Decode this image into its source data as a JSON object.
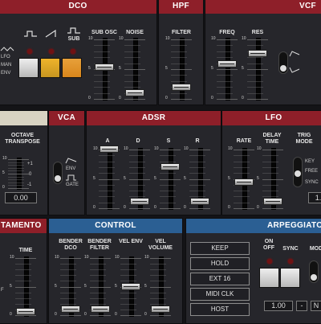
{
  "sections": {
    "dco": "DCO",
    "hpf": "HPF",
    "vcf": "VCF",
    "vca": "VCA",
    "adsr": "ADSR",
    "lfo": "LFO",
    "portamento": "TAMENTO",
    "control": "CONTROL",
    "arpeggiator": "ARPEGGIATOR"
  },
  "dco": {
    "sub_label": "SUB",
    "sub_osc_label": "SUB OSC",
    "noise_label": "NOISE",
    "lfo_mode": "LFO",
    "man_mode": "MAN",
    "env_mode": "ENV"
  },
  "hpf": {
    "filter_label": "FILTER"
  },
  "vcf": {
    "freq_label": "FREQ",
    "res_label": "RES"
  },
  "octave": {
    "label": "OCTAVE TRANSPOSE",
    "plus1": "+1",
    "zero": "0",
    "minus1": "-1",
    "value": "0.00"
  },
  "vca": {
    "env_label": "ENV",
    "gate_label": "GATE"
  },
  "adsr": {
    "a": "A",
    "d": "D",
    "s": "S",
    "r": "R"
  },
  "lfo": {
    "rate": "RATE",
    "delay": "DELAY TIME",
    "trig": "TRIG MODE",
    "key": "KEY",
    "free": "FREE",
    "sync": "SYNC",
    "value": "1."
  },
  "portamento": {
    "time": "TIME",
    "f": "F"
  },
  "control": {
    "bender_dco": "BENDER DCO",
    "bender_filter": "BENDER FILTER",
    "vel_env": "VEL ENV",
    "vel_volume": "VEL VOLUME"
  },
  "arp": {
    "on_off": "ON OFF",
    "sync": "SYNC",
    "mode": "MOD",
    "buttons": [
      "KEEP",
      "HOLD",
      "EXT 16",
      "MIDI CLK",
      "HOST"
    ],
    "value": "1.00",
    "minus": "-",
    "next": "N"
  },
  "scale_labels": {
    "top": "10",
    "mid": "5",
    "bottom": "0"
  },
  "colors": {
    "red": "#8e1f29",
    "blue": "#2b5f93",
    "orange": "#d9861c",
    "amber": "#c79620"
  }
}
